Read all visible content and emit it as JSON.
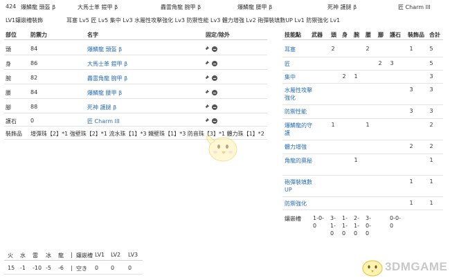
{
  "top_row": {
    "number": "424",
    "items": [
      "爆鱗龍 頭盔 β",
      "大馬士革 鎧甲 β",
      "轟雷角龍 腕甲 β",
      "爆鱗龍 腰甲 β",
      "死神 護腿 β",
      "匠 Charm III"
    ]
  },
  "skills_summary": {
    "left": "LV1鑲嵌槽裝飾",
    "right": "耳塞 Lv5 匠 Lv5 集中 Lv3 水屬性攻擊強化 Lv3 防禦性能 Lv3 體力增強 Lv2 砲彈裝填數UP Lv1 防禦強化 Lv1"
  },
  "equip_table": {
    "headers": {
      "part": "部位",
      "defense": "防禦力",
      "name": "名字",
      "fix": "固定/除外"
    },
    "rows": [
      {
        "part": "頭",
        "defense": "84",
        "name": "爆鱗龍 頭盔 β"
      },
      {
        "part": "身",
        "defense": "86",
        "name": "大馬士革 鎧甲 β"
      },
      {
        "part": "腕",
        "defense": "82",
        "name": "轟雷角龍 腕甲 β"
      },
      {
        "part": "腰",
        "defense": "84",
        "name": "爆鱗龍 腰甲 β"
      },
      {
        "part": "腳",
        "defense": "88",
        "name": "死神 護腿 β"
      },
      {
        "part": "護石",
        "defense": "0",
        "name": "匠 Charm III"
      }
    ],
    "decorations_label": "裝飾品",
    "decorations_value": "增彈珠【2】*1 強壁珠【2】*1 流水珠【1】*3 鐵壁珠【1】*3 防音珠【3】*1 體力珠【1】*2"
  },
  "skill_table": {
    "headers": [
      "技能點",
      "武器",
      "頭",
      "身",
      "腕",
      "腰",
      "腳",
      "護石",
      "裝飾品",
      "合計"
    ],
    "rows": [
      {
        "name": "耳塞",
        "values": [
          "",
          "2",
          "",
          "",
          "2",
          "",
          "",
          "1",
          "5"
        ]
      },
      {
        "name": "匠",
        "values": [
          "",
          "",
          "",
          "",
          "",
          "2",
          "3",
          "",
          "5"
        ]
      },
      {
        "name": "集中",
        "values": [
          "",
          "",
          "2",
          "1",
          "",
          "",
          "",
          "",
          "3"
        ]
      },
      {
        "name": "水屬性攻擊強化",
        "values": [
          "",
          "",
          "",
          "",
          "",
          "",
          "",
          "3",
          "3"
        ]
      },
      {
        "name": "防禦性能",
        "values": [
          "",
          "",
          "",
          "",
          "",
          "",
          "",
          "3",
          "3"
        ]
      },
      {
        "name": "爆鱗龍的守護",
        "values": [
          "",
          "1",
          "",
          "",
          "1",
          "",
          "",
          "",
          "2"
        ]
      },
      {
        "name": "體力增強",
        "values": [
          "",
          "",
          "",
          "",
          "",
          "",
          "",
          "2",
          "2"
        ]
      },
      {
        "name": "角龍的奧秘",
        "values": [
          "",
          "",
          "",
          "1",
          "",
          "",
          "",
          "",
          "1"
        ]
      },
      {
        "name": "砲彈裝填數UP",
        "values": [
          "",
          "",
          "",
          "",
          "",
          "",
          "",
          "1",
          "1"
        ]
      },
      {
        "name": "防禦強化",
        "values": [
          "",
          "",
          "",
          "",
          "",
          "",
          "",
          "1",
          "1"
        ]
      }
    ],
    "slots_label": "鑲嵌槽",
    "slots": [
      [
        "1-0-",
        "0"
      ],
      [
        "3-",
        "1-",
        "0"
      ],
      [
        "1-",
        "1-",
        "0"
      ],
      [
        "2-",
        "1-",
        "0"
      ],
      [
        "3-",
        "0-",
        "0"
      ],
      [
        "0-0-",
        "0"
      ]
    ]
  },
  "resist_table": {
    "headers": [
      "火",
      "水",
      "雷",
      "冰",
      "龍",
      "|",
      "鑲嵌槽",
      "LV1",
      "LV2",
      "LV3"
    ],
    "values": [
      "15",
      "-1",
      "-10",
      "-5",
      "-6",
      "|",
      "空き",
      "0",
      "0",
      "0"
    ]
  },
  "watermark": {
    "text": "3DMGAME"
  }
}
